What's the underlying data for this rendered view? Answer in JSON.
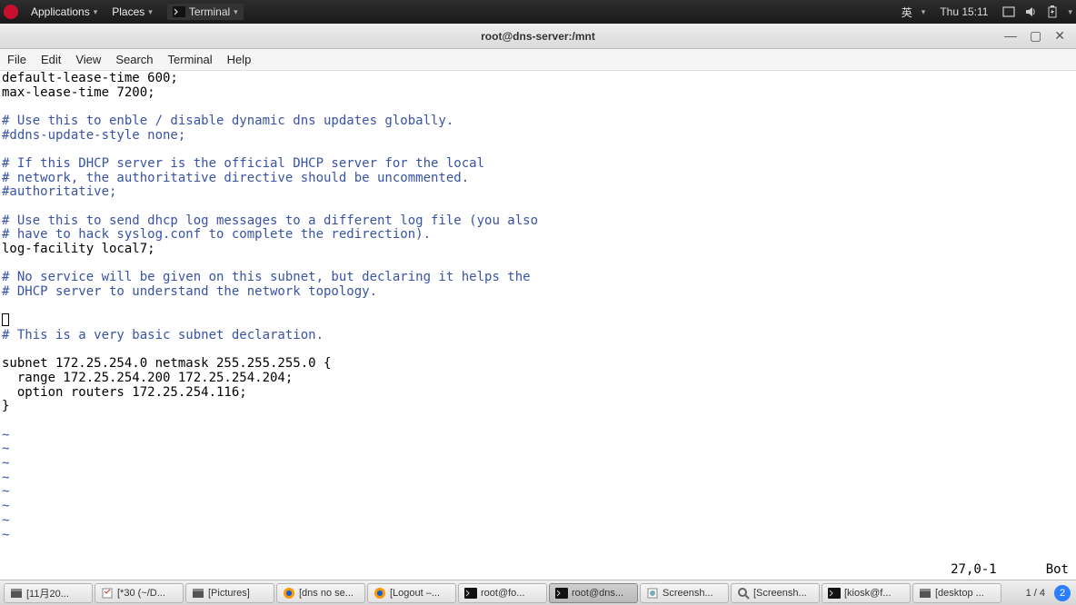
{
  "top_panel": {
    "applications": "Applications",
    "places": "Places",
    "terminal_launcher": "Terminal",
    "ime": "英",
    "clock": "Thu 15:11"
  },
  "window": {
    "title": "root@dns-server:/mnt",
    "menus": {
      "file": "File",
      "edit": "Edit",
      "view": "View",
      "search": "Search",
      "terminal": "Terminal",
      "help": "Help"
    }
  },
  "content": {
    "l1": "default-lease-time 600;",
    "l2": "max-lease-time 7200;",
    "l3": "",
    "c1": "# Use this to enble / disable dynamic dns updates globally.",
    "c2": "#ddns-update-style none;",
    "c3": "# If this DHCP server is the official DHCP server for the local",
    "c4": "# network, the authoritative directive should be uncommented.",
    "c5": "#authoritative;",
    "c6": "# Use this to send dhcp log messages to a different log file (you also",
    "c7": "# have to hack syslog.conf to complete the redirection).",
    "l4": "log-facility local7;",
    "c8": "# No service will be given on this subnet, but declaring it helps the",
    "c9": "# DHCP server to understand the network topology.",
    "c10": "# This is a very basic subnet declaration.",
    "l5": "subnet 172.25.254.0 netmask 255.255.255.0 {",
    "l6": "  range 172.25.254.200 172.25.254.204;",
    "l7": "  option routers 172.25.254.116;",
    "l8": "}",
    "tilde": "~"
  },
  "status": {
    "pos": "27,0-1",
    "scroll": "Bot"
  },
  "taskbar": {
    "items": [
      {
        "label": "[11月20..."
      },
      {
        "label": "[*30 (~/D..."
      },
      {
        "label": "[Pictures]"
      },
      {
        "label": "[dns no se..."
      },
      {
        "label": "[Logout –..."
      },
      {
        "label": "root@fo..."
      },
      {
        "label": "root@dns...",
        "active": true
      },
      {
        "label": "Screensh..."
      },
      {
        "label": "[Screensh..."
      },
      {
        "label": "[kiosk@f..."
      },
      {
        "label": "[desktop ..."
      }
    ],
    "workspace": "1 / 4",
    "notif": "2"
  }
}
